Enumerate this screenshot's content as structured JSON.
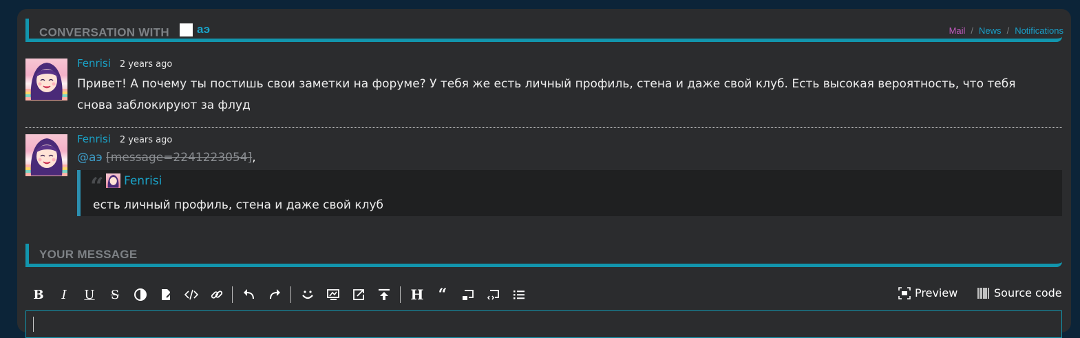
{
  "conversation": {
    "heading": "CONVERSATION WITH",
    "user": "аэ"
  },
  "breadcrumbs": [
    {
      "label": "Mail",
      "color": "#c25bc0"
    },
    {
      "label": "News",
      "color": "#1a9fc8"
    },
    {
      "label": "Notifications",
      "color": "#1a9fc8"
    }
  ],
  "messages": [
    {
      "author": "Fenrisi",
      "time": "2 years ago",
      "text": "Привет! А почему ты постишь свои заметки на форуме? У тебя же есть личный профиль, стена и даже свой клуб. Есть высокая вероятность, что тебя снова заблокируют за флуд"
    },
    {
      "author": "Fenrisi",
      "time": "2 years ago",
      "mention": "@аэ",
      "message_ref": "[message=2241223054]",
      "after_ref": ",",
      "quote": {
        "author": "Fenrisi",
        "text": "есть личный профиль, стена и даже свой клуб"
      }
    }
  ],
  "reply": {
    "heading": "YOUR MESSAGE"
  },
  "toolbar": {
    "preview_label": "Preview",
    "source_label": "Source code"
  },
  "colors": {
    "accent": "#1295ad",
    "link": "#1aa3c8",
    "panel": "#2b2c2e",
    "background": "#0c2438"
  }
}
